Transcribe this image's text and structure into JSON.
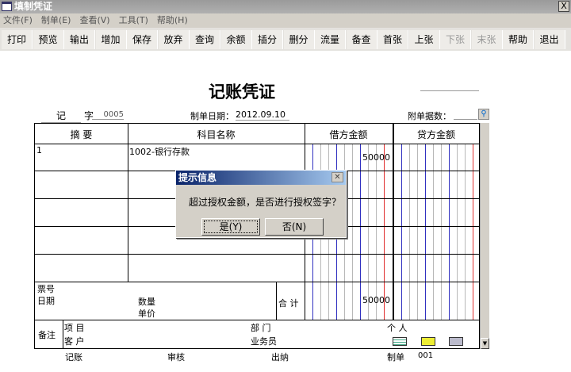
{
  "window": {
    "title": "填制凭证",
    "close": "X"
  },
  "menu": [
    "文件(F)",
    "制单(E)",
    "查看(V)",
    "工具(T)",
    "帮助(H)"
  ],
  "toolbar": [
    {
      "label": "打印"
    },
    {
      "label": "预览"
    },
    {
      "label": "输出"
    },
    {
      "label": "增加"
    },
    {
      "label": "保存"
    },
    {
      "label": "放弃"
    },
    {
      "label": "查询"
    },
    {
      "label": "余额"
    },
    {
      "label": "插分"
    },
    {
      "label": "删分"
    },
    {
      "label": "流量"
    },
    {
      "label": "备查"
    },
    {
      "label": "首张"
    },
    {
      "label": "上张"
    },
    {
      "label": "下张",
      "disabled": true
    },
    {
      "label": "末张",
      "disabled": true
    },
    {
      "label": "帮助"
    },
    {
      "label": "退出"
    }
  ],
  "voucher": {
    "title": "记账凭证",
    "type": "记",
    "zi": "字",
    "number": "0005",
    "date_label": "制单日期：",
    "date": "2012.09.10",
    "attach_label": "附单据数：",
    "headers": [
      "摘 要",
      "科目名称",
      "借方金额",
      "贷方金额"
    ],
    "rows": [
      {
        "summary": "1",
        "account": "1002-银行存款",
        "debit": "50000",
        "credit": ""
      },
      {},
      {},
      {},
      {}
    ],
    "footer": {
      "ticket": "票号",
      "date": "日期",
      "qty": "数量",
      "price": "单价",
      "total_label": "合 计",
      "total_debit": "50000"
    },
    "notes": {
      "label": "备注",
      "project": "项  目",
      "customer": "客  户",
      "dept": "部  门",
      "salesman": "业务员",
      "person": "个  人"
    },
    "sign": {
      "bookkeep": "记账",
      "audit": "审核",
      "cashier": "出纳",
      "maker_label": "制单",
      "maker": "001"
    }
  },
  "dialog": {
    "title": "提示信息",
    "message": "超过授权金额，是否进行授权签字？",
    "yes": "是(Y)",
    "no": "否(N)"
  }
}
